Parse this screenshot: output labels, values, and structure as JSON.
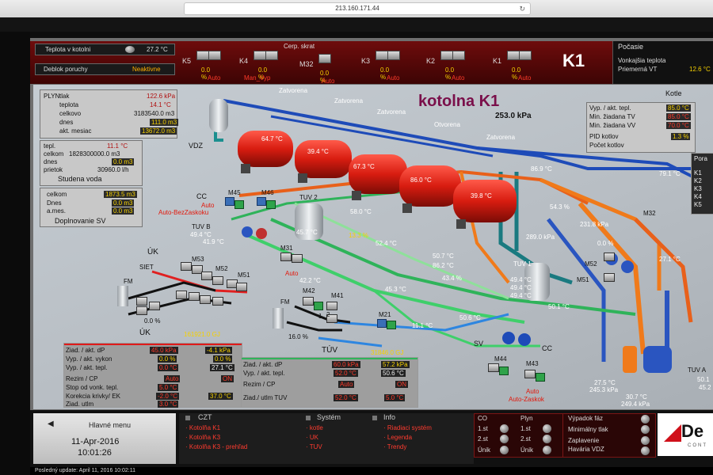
{
  "browser": {
    "url": "213.160.171.44"
  },
  "header": {
    "teplota_label": "Teplota v kotolni",
    "teplota_value": "27.2 °C",
    "deblok_label": "Deblok poruchy",
    "deblok_value": "Neaktivne",
    "cerp_label": "Cerp. skrat",
    "boilers": [
      {
        "name": "K5",
        "value": "0.0 %",
        "mode": "Auto"
      },
      {
        "name": "K4",
        "value": "0.0 %",
        "mode": "Man_Vyp"
      },
      {
        "name": "M32",
        "value": "0.0 %",
        "mode": "Auto"
      },
      {
        "name": "K3",
        "value": "0.0 %",
        "mode": "Auto"
      },
      {
        "name": "K2",
        "value": "0.0 %",
        "mode": "Auto"
      },
      {
        "name": "K1",
        "value": "0.0 %",
        "mode": "Auto"
      }
    ],
    "station": "K1"
  },
  "weather": {
    "title": "Počasie",
    "vonk_label": "Vonkajšia teplota",
    "priem_label": "Priemerná VT",
    "priem_value": "12.6 °C"
  },
  "scene": {
    "title": "kotolna K1",
    "pressure": "253.0 kPa",
    "valves": [
      "Zatvorena",
      "Zatvorena",
      "Zatvorena",
      "Otvorena",
      "Zatvorena"
    ],
    "boiler_temps": [
      "64.7 °C",
      "39.4 °C",
      "67.3 °C",
      "86.0 °C",
      "39.8 °C"
    ],
    "plyn": {
      "title": "PLYN",
      "rows": [
        [
          "tlak",
          "122.6 kPa"
        ],
        [
          "teplota",
          "14.1 °C"
        ],
        [
          "celkovo",
          "3183540.0 m3"
        ],
        [
          "dnes",
          "111.0 m3"
        ],
        [
          "akt. mesiac",
          "13672.0 m3"
        ]
      ]
    },
    "sv": {
      "rows": [
        [
          "tepl.",
          "11.1 °C"
        ],
        [
          "celkom",
          "1828300000.0 m3"
        ],
        [
          "dnes",
          "0.0 m3"
        ],
        [
          "prietok",
          "30960.0 l/h"
        ]
      ],
      "caption": "Studena voda"
    },
    "dsv": {
      "rows": [
        [
          "celkom",
          "1873.5 m3"
        ],
        [
          "Dnes",
          "0.0 m3"
        ],
        [
          "a.mes.",
          "0.0 m3"
        ]
      ],
      "caption": "Doplnovanie SV"
    },
    "kotle": {
      "title": "Kotle",
      "rows": [
        [
          "Vyp. / akt. tepl.",
          "85.0 °C"
        ],
        [
          "Min. žiadana TV",
          "85.0 °C"
        ],
        [
          "Min. žiadana VV",
          "70.0 °C"
        ],
        [
          "PID kotlov",
          "1.3 %"
        ],
        [
          "Počet kotlov",
          ""
        ]
      ]
    },
    "porad": {
      "title": "Pora",
      "items": [
        "K1",
        "K2",
        "K3",
        "K4",
        "K5"
      ]
    },
    "labels": {
      "vdz": "VDZ",
      "cc": "CC",
      "cc_mode": "Auto",
      "cc_mode2": "Auto-BezZaskoku",
      "m45": "M45",
      "m46": "M46",
      "tuv2": "TUV 2",
      "tuvb": "TUV B",
      "tuvb_t1": "49.4 °C",
      "tuvb_t2": "41.9 °C",
      "t457": "45.7 °C",
      "t580": "58.0 °C",
      "t133": "13.3 %",
      "t524": "52.4 °C",
      "t869": "86.9 °C",
      "t791": "79.1 °C",
      "t543": "54.3 %",
      "t2318": "231.8 kPa",
      "t289": "289.0 kPa",
      "m32": "M32",
      "m52r": "M52",
      "m51r": "M51",
      "p00r": "0.0 %",
      "t271r": "27.1 °C",
      "uk": "ÚK",
      "siet": "SIET",
      "m53": "M53",
      "m52": "M52",
      "m51": "M51",
      "fm": "FM",
      "p00": "0.0 %",
      "m31": "M31",
      "m31mode": "Auto",
      "t422": "42.2 °C",
      "t453": "45.3 °C",
      "m42": "M42",
      "m41": "M41",
      "fm2": "FM",
      "n1": "1",
      "n2": "2",
      "p160": "16.0 %",
      "t507": "50.7 °C",
      "t862": "86.2 °C",
      "t434": "43.4 %",
      "tuv1": "TUV 1",
      "tuv1_a": "49.4 °C",
      "tuv1_b": "49.4 °C",
      "tuv1_c": "49.4 °C",
      "t501": "50.1 °C",
      "t506": "50.6 °C",
      "sv": "SV",
      "m21": "M21",
      "t111": "11.1 °C",
      "m44": "M44",
      "m43": "M43",
      "m43mode": "Auto",
      "m43mode2": "Auto-Zaskok",
      "cc2": "CC",
      "t275": "27.5 °C",
      "t2453": "245.3 kPa",
      "t307": "30.7 °C",
      "t2494": "249.4 kPa",
      "tuva": "TUV A",
      "t501b": "50.1",
      "t452": "45.2"
    },
    "uk_gj": "161921.0 GJ",
    "tuv_gj": "31846.0 GJ",
    "uk_panel": {
      "title": "ÚK",
      "rows": [
        [
          "Ziad. / akt. dP",
          "45.0 kPa",
          "-4.1 kPa"
        ],
        [
          "Vyp. / akt. vykon",
          "0.0 %",
          "0.0 %"
        ],
        [
          "Vyp. / akt. tepl.",
          "0.0 °C",
          "27.1 °C"
        ],
        [
          "Rezim / CP",
          "Auto",
          "ON"
        ],
        [
          "Stop od vonk. tepl.",
          "5.0 °C",
          ""
        ],
        [
          "Korekcia krivky/ EK",
          "-2.0 °C",
          "37.0 °C"
        ],
        [
          "Ziad. utlm",
          "3.0 °C",
          ""
        ]
      ]
    },
    "tuv_panel": {
      "title": "TÚV",
      "rows": [
        [
          "Ziad. / akt. dP",
          "60.0 kPa",
          "57.2 kPa"
        ],
        [
          "Vyp. / akt. tepl.",
          "52.0 °C",
          "50.6 °C"
        ],
        [
          "Rezim / CP",
          "Auto",
          "ON"
        ],
        [
          "Ziad./ utlm TUV",
          "52.0 °C",
          "5.0 °C"
        ]
      ]
    }
  },
  "footer": {
    "hlavne": "Hlavné menu",
    "date": "11-Apr-2016",
    "time": "10:01:26",
    "czt": {
      "title": "CZT",
      "items": [
        "Kotolňa K1",
        "Kotolňa K3",
        "Kotolňa K3 - prehľad"
      ]
    },
    "system": {
      "title": "Systém",
      "items": [
        "kotle",
        "UK",
        "TUV"
      ]
    },
    "info": {
      "title": "Info",
      "items": [
        "Riadiaci systém",
        "Legenda",
        "Trendy"
      ]
    },
    "co": {
      "title": "CO",
      "items": [
        "1.st",
        "2.st",
        "Únik"
      ]
    },
    "plyn": {
      "title": "Plyn",
      "items": [
        "1.st",
        "2.st",
        "Únik"
      ]
    },
    "alarms": [
      "Výpadok fáz",
      "Minimálny tlak",
      "Zaplavenie",
      "Havária VDZ"
    ],
    "logo": "De",
    "logo_sub": "CONT",
    "update": "Posledný update: April 11, 2016 10:02:11"
  }
}
